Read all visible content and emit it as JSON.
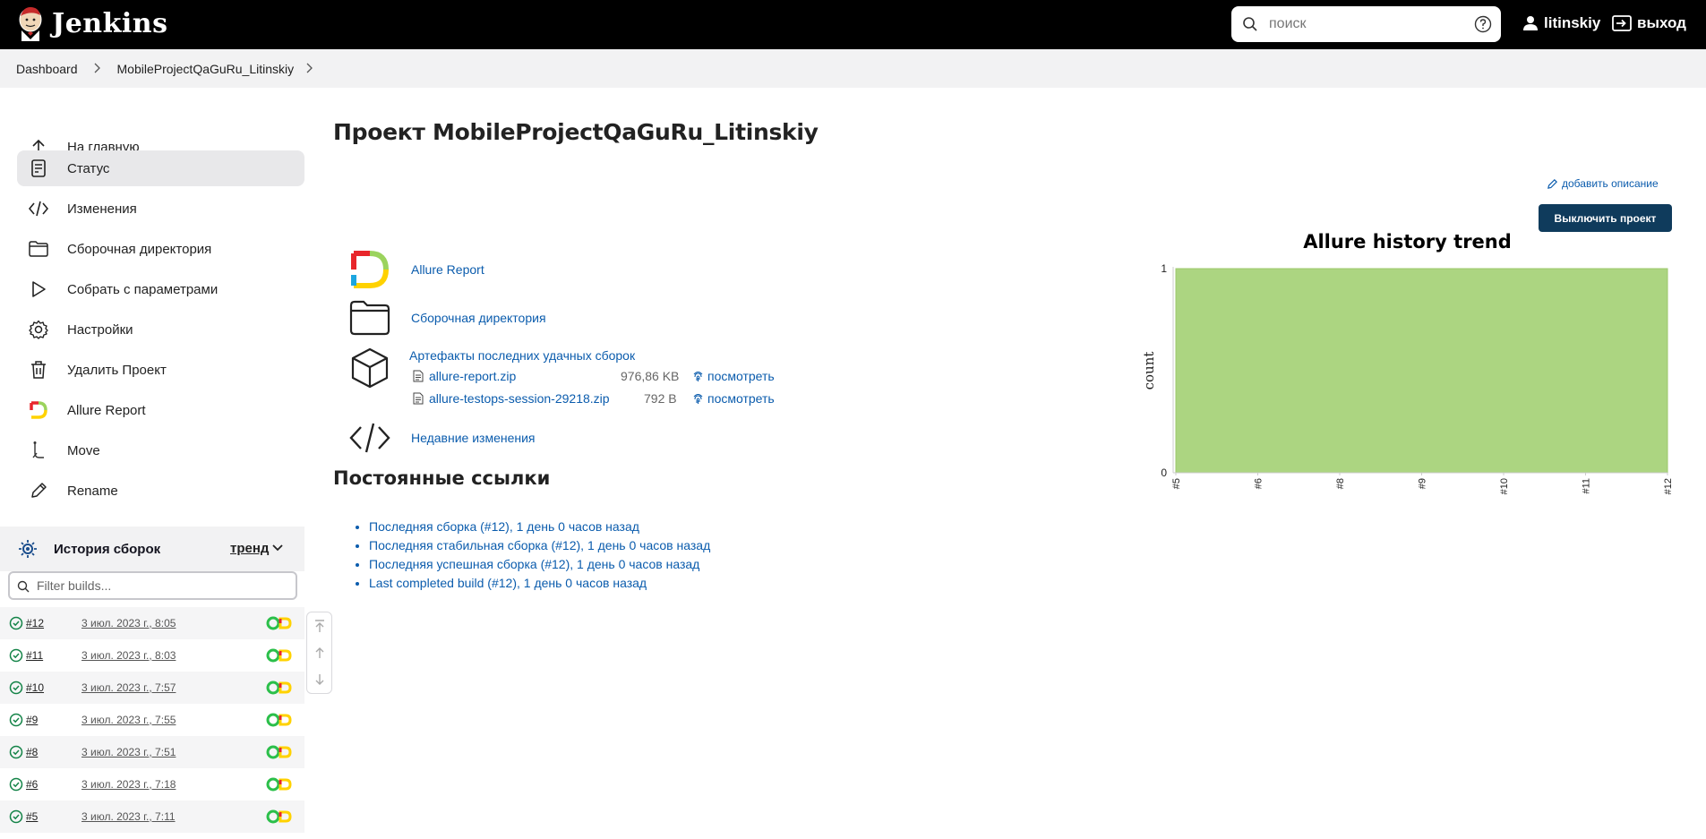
{
  "header": {
    "app_name": "Jenkins",
    "search_placeholder": "поиск",
    "user_name": "litinskiy",
    "logout_label": "выход"
  },
  "breadcrumb": [
    "Dashboard",
    "MobileProjectQaGuRu_Litinskiy"
  ],
  "sidebar": {
    "tasks": [
      {
        "label": "На главную",
        "icon": "arrow-up-icon",
        "active": false
      },
      {
        "label": "Статус",
        "icon": "document-icon",
        "active": true
      },
      {
        "label": "Изменения",
        "icon": "code-icon",
        "active": false
      },
      {
        "label": "Сборочная директория",
        "icon": "folder-icon",
        "active": false
      },
      {
        "label": "Собрать с параметрами",
        "icon": "play-icon",
        "active": false
      },
      {
        "label": "Настройки",
        "icon": "gear-icon",
        "active": false
      },
      {
        "label": "Удалить Проект",
        "icon": "trash-icon",
        "active": false
      },
      {
        "label": "Allure Report",
        "icon": "allure-icon",
        "active": false
      },
      {
        "label": "Move",
        "icon": "move-icon",
        "active": false
      },
      {
        "label": "Rename",
        "icon": "pencil-icon",
        "active": false
      }
    ],
    "history": {
      "title": "История сборок",
      "trend_label": "тренд",
      "filter_placeholder": "Filter builds...",
      "builds": [
        {
          "number": "#12",
          "date": "3 июл. 2023 г., 8:05"
        },
        {
          "number": "#11",
          "date": "3 июл. 2023 г., 8:03"
        },
        {
          "number": "#10",
          "date": "3 июл. 2023 г., 7:57"
        },
        {
          "number": "#9",
          "date": "3 июл. 2023 г., 7:55"
        },
        {
          "number": "#8",
          "date": "3 июл. 2023 г., 7:51"
        },
        {
          "number": "#6",
          "date": "3 июл. 2023 г., 7:18"
        },
        {
          "number": "#5",
          "date": "3 июл. 2023 г., 7:11"
        }
      ]
    }
  },
  "main": {
    "title": "Проект MobileProjectQaGuRu_Litinskiy",
    "add_description": "добавить описание",
    "disable_button": "Выключить проект",
    "links": {
      "allure_report": "Allure Report",
      "workspace": "Сборочная директория",
      "artifacts_title": "Артефакты последних удачных сборок",
      "recent_changes": "Недавние изменения"
    },
    "artifacts": [
      {
        "name": "allure-report.zip",
        "size": "976,86 KB",
        "view": "посмотреть"
      },
      {
        "name": "allure-testops-session-29218.zip",
        "size": "792 B",
        "view": "посмотреть"
      }
    ],
    "permalinks_title": "Постоянные ссылки",
    "permalinks": [
      "Последняя сборка (#12), 1 день 0 часов назад",
      "Последняя стабильная сборка (#12), 1 день 0 часов назад",
      "Последняя успешная сборка (#12), 1 день 0 часов назад",
      "Last completed build (#12), 1 день 0 часов назад"
    ]
  },
  "chart_data": {
    "type": "area",
    "title": "Allure history trend",
    "xlabel": "",
    "ylabel": "count",
    "x": [
      "#5",
      "#6",
      "#8",
      "#9",
      "#10",
      "#11",
      "#12"
    ],
    "series": [
      {
        "values": [
          1,
          1,
          1,
          1,
          1,
          1,
          1
        ],
        "color": "#acd581"
      }
    ],
    "ylim": [
      0,
      1
    ],
    "yticks": [
      0,
      1
    ]
  }
}
